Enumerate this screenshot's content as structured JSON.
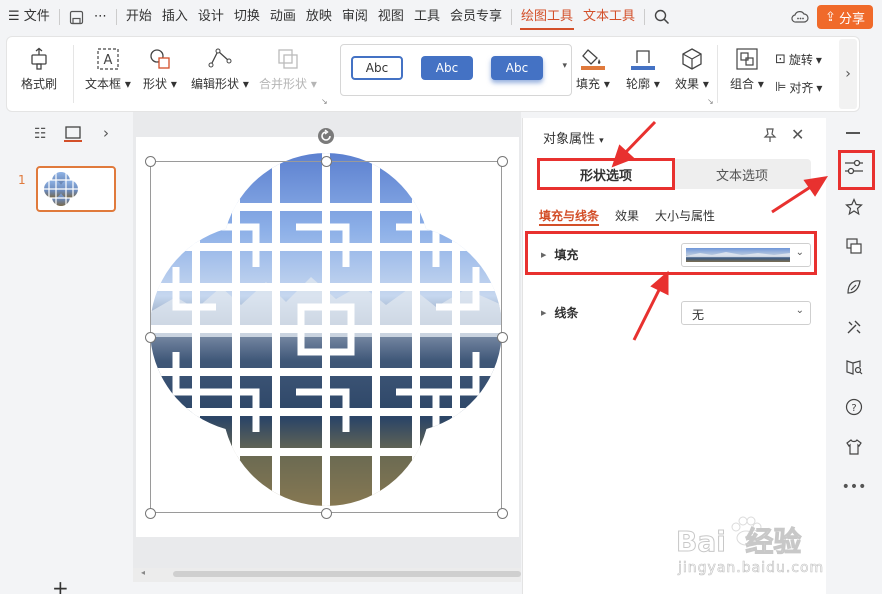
{
  "menubar": {
    "menu_label": "文件",
    "items": [
      "开始",
      "插入",
      "设计",
      "切换",
      "动画",
      "放映",
      "审阅",
      "视图",
      "工具",
      "会员专享"
    ],
    "context_tabs": [
      "绘图工具",
      "文本工具"
    ],
    "share_label": "分享"
  },
  "ribbon": {
    "format_painter": "格式刷",
    "textbox": "文本框",
    "shape": "形状",
    "edit_shape": "编辑形状",
    "merge_shape": "合并形状",
    "styles": [
      "Abc",
      "Abc",
      "Abc"
    ],
    "fill": "填充",
    "outline": "轮廓",
    "effect": "效果",
    "group": "组合",
    "rotate": "旋转",
    "align": "对齐"
  },
  "slides": {
    "current_number": "1"
  },
  "panel": {
    "title": "对象属性",
    "tabs": [
      "形状选项",
      "文本选项"
    ],
    "subtabs": [
      "填充与线条",
      "效果",
      "大小与属性"
    ],
    "fill_label": "填充",
    "line_label": "线条",
    "line_value": "无"
  },
  "watermark": {
    "brand": "Bai  经验",
    "url": "jingyan.baidu.com"
  },
  "colors": {
    "accent": "#d34f29",
    "share": "#f06a2a",
    "highlight": "#e8312f",
    "style_blue": "#4472c4"
  }
}
